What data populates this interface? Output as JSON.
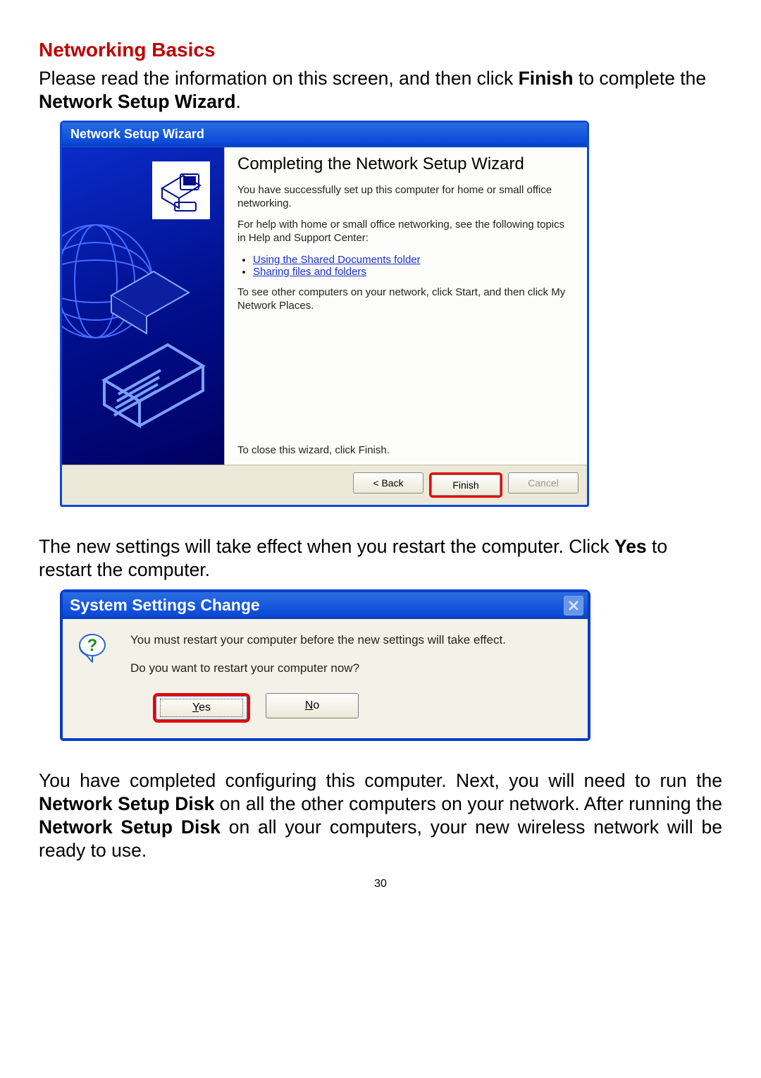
{
  "page_number": "30",
  "section_title": "Networking Basics",
  "intro": {
    "before_finish": "Please read the information on this screen, and then click ",
    "finish_word": "Finish",
    "after_finish": " to complete the ",
    "wizard_phrase": "Network Setup Wizard",
    "period": "."
  },
  "wizard": {
    "title": "Network Setup Wizard",
    "heading": "Completing the Network Setup Wizard",
    "p1": "You have successfully set up this computer for home or small office networking.",
    "p2": "For help with home or small office networking, see the following topics in Help and Support Center:",
    "links": {
      "0": "Using the Shared Documents folder",
      "1": "Sharing files and folders"
    },
    "p3": "To see other computers on your network, click Start, and then click My Network Places.",
    "close_line": "To close this wizard, click Finish.",
    "buttons": {
      "back": "< Back",
      "finish": "Finish",
      "cancel": "Cancel"
    }
  },
  "mid_text": {
    "pre": "The new settings will take effect when you restart the computer.  Click ",
    "yes_word": "Yes",
    "post": " to restart the computer."
  },
  "msgbox": {
    "title": "System Settings Change",
    "p1": "You must restart your computer before the new settings will take effect.",
    "p2": "Do you want to restart your computer now?",
    "buttons": {
      "yes_char": "Y",
      "yes_rest": "es",
      "no_char": "N",
      "no_rest": "o"
    }
  },
  "final": {
    "t1": "You have completed configuring this computer.  Next, you will need to run the ",
    "disk1": "Network Setup Disk",
    "t2": " on all the other computers on your network.  After running the ",
    "disk2": "Network Setup Disk",
    "t3": " on all your computers, your new wireless network will be ready to use."
  }
}
